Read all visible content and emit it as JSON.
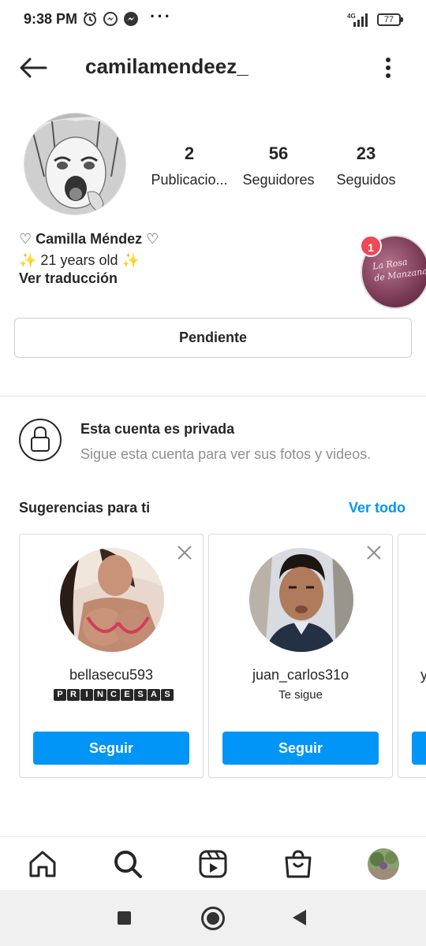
{
  "status_bar": {
    "time": "9:38 PM",
    "network": "4G",
    "battery": "77",
    "icons": [
      "alarm-icon",
      "messenger-icon",
      "messenger-icon",
      "more-dots-icon"
    ]
  },
  "header": {
    "username": "camilamendeez_",
    "back_icon": "arrow-left-icon",
    "menu_icon": "vertical-dots-icon"
  },
  "profile": {
    "stats": [
      {
        "value": "2",
        "label": "Publicacio..."
      },
      {
        "value": "56",
        "label": "Seguidores"
      },
      {
        "value": "23",
        "label": "Seguidos"
      }
    ],
    "bio_name": "♡ Camilla Méndez ♡",
    "bio_line2_sparkle_left": "✨",
    "bio_line2_text": " 21 years old ",
    "bio_line2_sparkle_right": "✨",
    "translate": "Ver traducción",
    "highlight": {
      "text_line1": "La Rosa",
      "text_line2": "de Manzana",
      "badge": "1"
    },
    "pending_button": "Pendiente"
  },
  "private": {
    "title": "Esta cuenta es privada",
    "subtitle": "Sigue esta cuenta para ver sus fotos y videos."
  },
  "suggestions": {
    "title": "Sugerencias para ti",
    "see_all": "Ver todo",
    "cards": [
      {
        "username": "bellasecu593",
        "subtitle_letters": [
          "P",
          "R",
          "I",
          "N",
          "C",
          "E",
          "S",
          "A",
          "S"
        ],
        "button": "Seguir"
      },
      {
        "username": "juan_carlos31o",
        "subtitle": "Te sigue",
        "button": "Seguir"
      },
      {
        "username": "y",
        "button": ""
      }
    ]
  },
  "bottom_nav": [
    "home-icon",
    "search-icon",
    "reels-icon",
    "shop-icon",
    "profile-avatar"
  ],
  "colors": {
    "accent": "#0095f6",
    "badge": "#ed4956",
    "text": "#262626",
    "muted": "#8e8e8e"
  }
}
